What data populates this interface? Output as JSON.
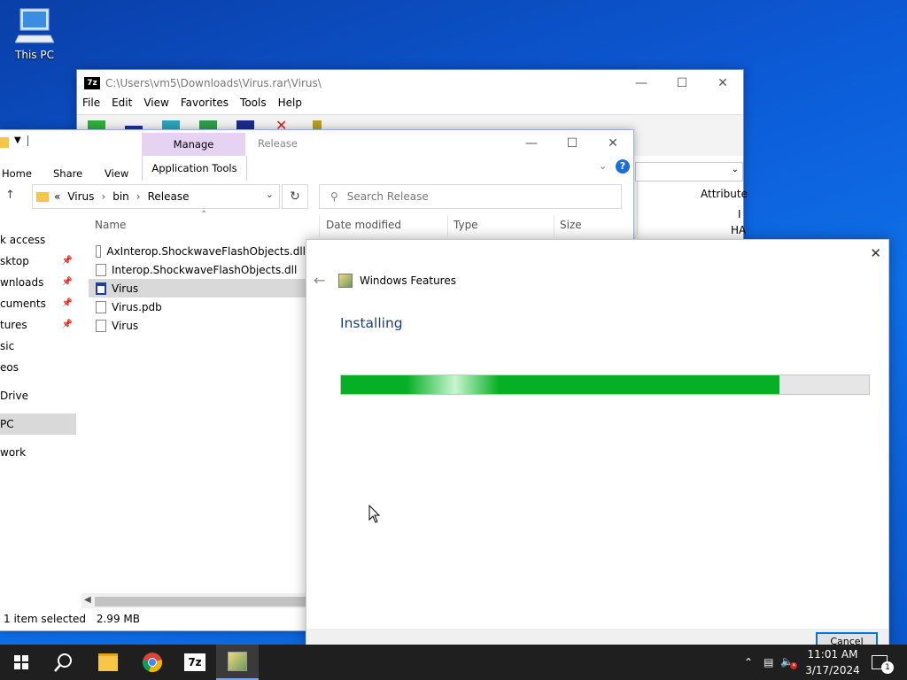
{
  "desktop": {
    "this_pc_label": "This PC"
  },
  "sevenzip": {
    "path": "C:\\Users\\vm5\\Downloads\\Virus.rar\\Virus\\",
    "logo": "7z",
    "menu": [
      "File",
      "Edit",
      "View",
      "Favorites",
      "Tools",
      "Help"
    ],
    "col_attributes": "Attribute",
    "row_fragments": [
      "I",
      "HA"
    ]
  },
  "explorer": {
    "tabs": {
      "home": "Home",
      "share": "Share",
      "view": "View"
    },
    "manage": "Manage",
    "release": "Release",
    "application_tools": "Application Tools",
    "breadcrumb": [
      "Virus",
      "bin",
      "Release"
    ],
    "breadcrumb_prefix": "«",
    "search_placeholder": "Search Release",
    "columns": {
      "name": "Name",
      "date": "Date modified",
      "type": "Type",
      "size": "Size"
    },
    "sidebar": [
      "k access",
      "sktop",
      "wnloads",
      "cuments",
      "tures",
      "sic",
      "eos",
      "Drive",
      "PC",
      "work"
    ],
    "files": [
      {
        "name": "AxInterop.ShockwaveFlashObjects.dll"
      },
      {
        "name": "Interop.ShockwaveFlashObjects.dll"
      },
      {
        "name": "Virus"
      },
      {
        "name": "Virus.pdb"
      },
      {
        "name": "Virus"
      }
    ],
    "status": {
      "selected": "1 item selected",
      "size": "2.99 MB"
    }
  },
  "windows_features": {
    "title": "Windows Features",
    "heading": "Installing",
    "progress": 0.83,
    "cancel_label": "Cancel"
  },
  "taskbar": {
    "time": "11:01 AM",
    "date": "3/17/2024",
    "notification_count": "1",
    "colors": {
      "accent": "#0078d7",
      "progress": "#06b025"
    }
  }
}
